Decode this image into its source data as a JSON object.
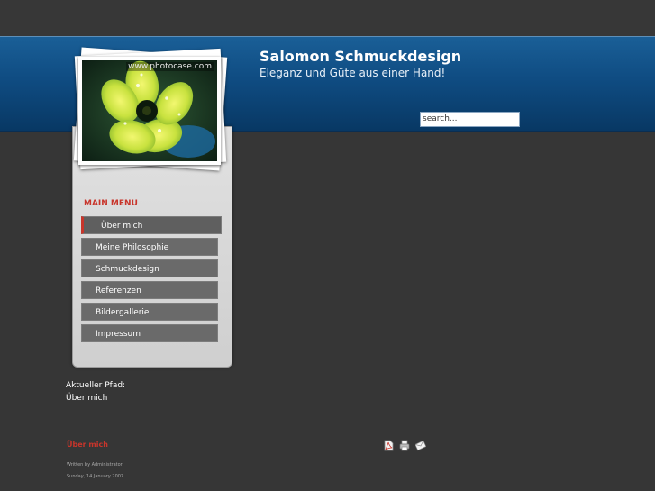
{
  "header": {
    "site_title": "Salomon Schmuckdesign",
    "slogan": "Eleganz und Güte aus einer Hand!",
    "search_value": "search..."
  },
  "photo": {
    "watermark": "www.photocase.com"
  },
  "menu": {
    "title": "MAIN MENU",
    "items": [
      {
        "label": "Über mich",
        "active": true
      },
      {
        "label": "Meine Philosophie",
        "active": false
      },
      {
        "label": "Schmuckdesign",
        "active": false
      },
      {
        "label": "Referenzen",
        "active": false
      },
      {
        "label": "Bildergallerie",
        "active": false
      },
      {
        "label": "Impressum",
        "active": false
      }
    ]
  },
  "pathway": {
    "label": "Aktueller Pfad:",
    "current": "Über mich"
  },
  "article": {
    "title": "Über mich",
    "written_by": "Written by Administrator",
    "date": "Sunday, 14 January 2007"
  },
  "icons": [
    "pdf-icon",
    "print-icon",
    "email-icon"
  ],
  "colors": {
    "accent": "#c8352b",
    "banner": "#0f4c82",
    "background": "#363636"
  }
}
